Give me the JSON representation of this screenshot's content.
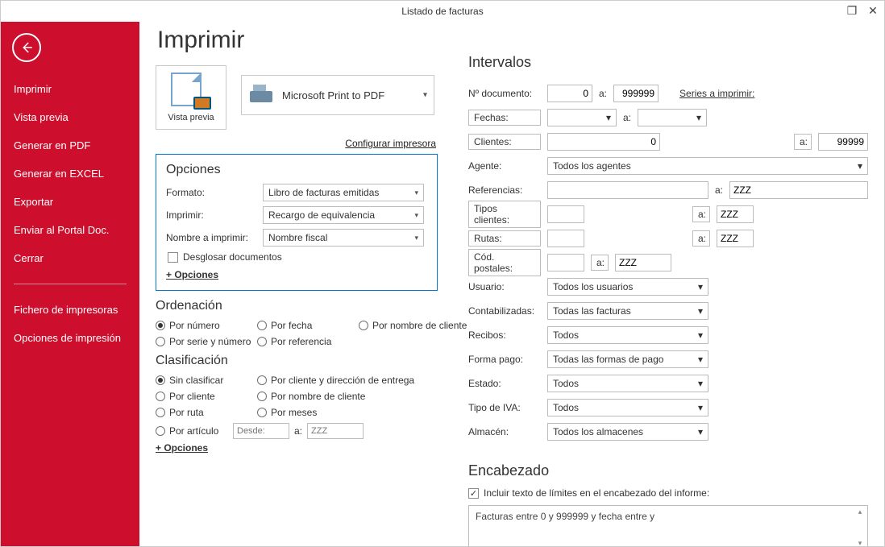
{
  "window": {
    "title": "Listado de facturas"
  },
  "page_title": "Imprimir",
  "sidebar": {
    "items": [
      "Imprimir",
      "Vista previa",
      "Generar en PDF",
      "Generar en EXCEL",
      "Exportar",
      "Enviar al Portal Doc.",
      "Cerrar"
    ],
    "after_divider": [
      "Fichero de impresoras",
      "Opciones de impresión"
    ]
  },
  "preview": {
    "label": "Vista previa"
  },
  "printer": {
    "name": "Microsoft Print to PDF",
    "configure": "Configurar impresora"
  },
  "opciones": {
    "title": "Opciones",
    "formato_lbl": "Formato:",
    "formato_val": "Libro de facturas emitidas",
    "imprimir_lbl": "Imprimir:",
    "imprimir_val": "Recargo de equivalencia",
    "nombre_lbl": "Nombre a imprimir:",
    "nombre_val": "Nombre fiscal",
    "desglosar": "Desglosar documentos",
    "more": "+ Opciones"
  },
  "ordenacion": {
    "title": "Ordenación",
    "r1": "Por número",
    "r2": "Por fecha",
    "r3": "Por nombre de cliente",
    "r4": "Por serie y número",
    "r5": "Por referencia"
  },
  "clasificacion": {
    "title": "Clasificación",
    "r1": "Sin clasificar",
    "r2": "Por cliente y dirección de entrega",
    "r3": "Por cliente",
    "r4": "Por nombre de cliente",
    "r5": "Por ruta",
    "r6": "Por meses",
    "r7": "Por artículo",
    "desde_ph": "Desde:",
    "a_lbl": "a:",
    "zzz_ph": "ZZZ",
    "more": "+ Opciones"
  },
  "intervalos": {
    "title": "Intervalos",
    "ndoc_lbl": "Nº documento:",
    "ndoc_from": "0",
    "a": "a:",
    "ndoc_to": "999999",
    "series": "Series a imprimir:",
    "fechas_lbl": "Fechas:",
    "fechas_from": "",
    "fechas_to": "",
    "clientes_lbl": "Clientes:",
    "clientes_from": "0",
    "clientes_to": "99999",
    "agente_lbl": "Agente:",
    "agente_val": "Todos los agentes",
    "ref_lbl": "Referencias:",
    "ref_from": "",
    "ref_to": "ZZZ",
    "tipos_lbl": "Tipos clientes:",
    "tipos_from": "",
    "tipos_to": "ZZZ",
    "rutas_lbl": "Rutas:",
    "rutas_from": "",
    "rutas_to": "ZZZ",
    "cp_lbl": "Cód. postales:",
    "cp_from": "",
    "cp_a": "a:",
    "cp_to": "ZZZ",
    "usuario_lbl": "Usuario:",
    "usuario_val": "Todos los usuarios",
    "contab_lbl": "Contabilizadas:",
    "contab_val": "Todas las facturas",
    "recibos_lbl": "Recibos:",
    "recibos_val": "Todos",
    "fpago_lbl": "Forma pago:",
    "fpago_val": "Todas las formas de pago",
    "estado_lbl": "Estado:",
    "estado_val": "Todos",
    "iva_lbl": "Tipo de IVA:",
    "iva_val": "Todos",
    "almacen_lbl": "Almacén:",
    "almacen_val": "Todos los almacenes"
  },
  "encabezado": {
    "title": "Encabezado",
    "chk_lbl": "Incluir texto de límites en el encabezado del informe:",
    "text": "Facturas entre 0 y 999999 y fecha entre  y"
  }
}
